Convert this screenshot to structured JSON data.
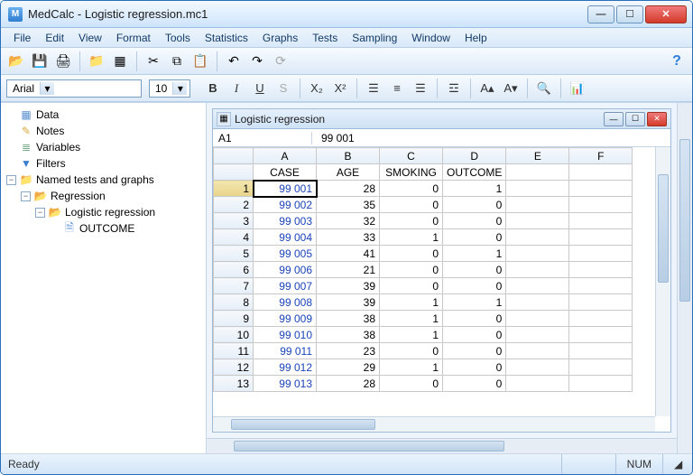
{
  "window": {
    "title": "MedCalc - Logistic regression.mc1"
  },
  "menu": [
    "File",
    "Edit",
    "View",
    "Format",
    "Tools",
    "Statistics",
    "Graphs",
    "Tests",
    "Sampling",
    "Window",
    "Help"
  ],
  "toolbar": {
    "icons": [
      {
        "name": "open-icon",
        "glyph": "📂"
      },
      {
        "name": "save-icon",
        "glyph": "💾"
      },
      {
        "name": "print-icon",
        "glyph": "🖨"
      },
      {
        "name": "sep"
      },
      {
        "name": "folder-icon",
        "glyph": "📁"
      },
      {
        "name": "grid-icon",
        "glyph": "▦"
      },
      {
        "name": "sep"
      },
      {
        "name": "cut-icon",
        "glyph": "✂"
      },
      {
        "name": "copy-icon",
        "glyph": "⧉"
      },
      {
        "name": "paste-icon",
        "glyph": "📋"
      },
      {
        "name": "sep"
      },
      {
        "name": "undo-icon",
        "glyph": "↶"
      },
      {
        "name": "redo-icon",
        "glyph": "↷"
      },
      {
        "name": "refresh-icon",
        "glyph": "⟳"
      }
    ]
  },
  "format": {
    "font": "Arial",
    "size": "10"
  },
  "tree": {
    "items": [
      {
        "icon": "sheet",
        "label": "Data"
      },
      {
        "icon": "note",
        "label": "Notes"
      },
      {
        "icon": "var",
        "label": "Variables"
      },
      {
        "icon": "filter",
        "label": "Filters"
      }
    ],
    "named": {
      "label": "Named tests and graphs",
      "regression": {
        "label": "Regression"
      },
      "logistic": {
        "label": "Logistic regression"
      },
      "outcome": {
        "label": "OUTCOME"
      }
    }
  },
  "inner": {
    "title": "Logistic regression",
    "cellref": "A1",
    "cellval": "99 001"
  },
  "sheet": {
    "cols": [
      "A",
      "B",
      "C",
      "D",
      "E",
      "F"
    ],
    "headers": [
      "CASE",
      "AGE",
      "SMOKING",
      "OUTCOME",
      "",
      ""
    ],
    "rows": [
      {
        "n": 1,
        "a": "99 001",
        "b": "28",
        "c": "0",
        "d": "1"
      },
      {
        "n": 2,
        "a": "99 002",
        "b": "35",
        "c": "0",
        "d": "0"
      },
      {
        "n": 3,
        "a": "99 003",
        "b": "32",
        "c": "0",
        "d": "0"
      },
      {
        "n": 4,
        "a": "99 004",
        "b": "33",
        "c": "1",
        "d": "0"
      },
      {
        "n": 5,
        "a": "99 005",
        "b": "41",
        "c": "0",
        "d": "1"
      },
      {
        "n": 6,
        "a": "99 006",
        "b": "21",
        "c": "0",
        "d": "0"
      },
      {
        "n": 7,
        "a": "99 007",
        "b": "39",
        "c": "0",
        "d": "0"
      },
      {
        "n": 8,
        "a": "99 008",
        "b": "39",
        "c": "1",
        "d": "1"
      },
      {
        "n": 9,
        "a": "99 009",
        "b": "38",
        "c": "1",
        "d": "0"
      },
      {
        "n": 10,
        "a": "99 010",
        "b": "38",
        "c": "1",
        "d": "0"
      },
      {
        "n": 11,
        "a": "99 011",
        "b": "23",
        "c": "0",
        "d": "0"
      },
      {
        "n": 12,
        "a": "99 012",
        "b": "29",
        "c": "1",
        "d": "0"
      },
      {
        "n": 13,
        "a": "99 013",
        "b": "28",
        "c": "0",
        "d": "0"
      }
    ]
  },
  "status": {
    "ready": "Ready",
    "num": "NUM"
  }
}
